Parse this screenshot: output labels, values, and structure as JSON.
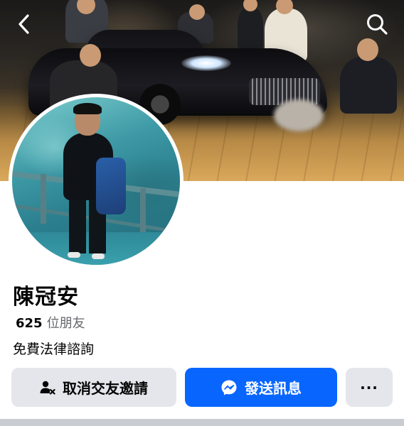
{
  "profile": {
    "name": "陳冠安",
    "friends_count": "625",
    "friends_label": "位朋友",
    "bio": "免費法律諮詢"
  },
  "actions": {
    "cancel_request_label": "取消交友邀請",
    "send_message_label": "發送訊息",
    "more_label": "..."
  },
  "icons": {
    "back": "chevron-left-icon",
    "search": "search-icon",
    "cancel_request": "person-remove-icon",
    "messenger": "messenger-icon",
    "more": "more-horizontal-icon"
  },
  "colors": {
    "primary_button": "#0866ff",
    "secondary_button": "#e4e6eb",
    "text_primary": "#050505",
    "text_secondary": "#65676b"
  }
}
